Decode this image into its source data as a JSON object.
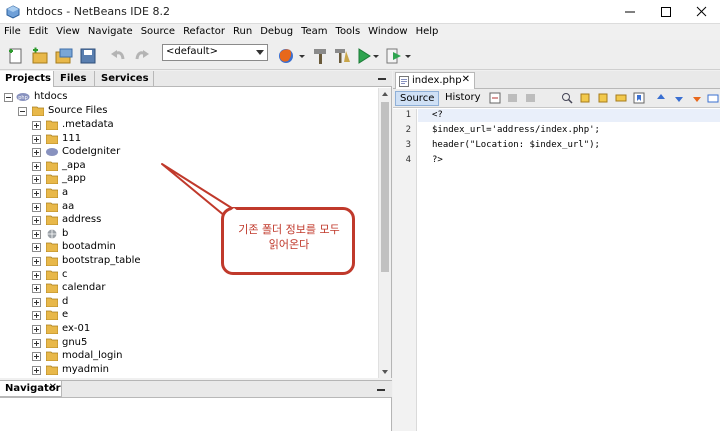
{
  "window": {
    "title": "htdocs - NetBeans IDE 8.2"
  },
  "menu": [
    "File",
    "Edit",
    "View",
    "Navigate",
    "Source",
    "Refactor",
    "Run",
    "Debug",
    "Team",
    "Tools",
    "Window",
    "Help"
  ],
  "toolbar": {
    "config_select": "<default>"
  },
  "left_tabs": {
    "projects": "Projects",
    "files": "Files",
    "services": "Services"
  },
  "tree": {
    "root": "htdocs",
    "source_files": "Source Files",
    "items": [
      ".metadata",
      "111",
      "CodeIgniter",
      "_apa",
      "_app",
      "a",
      "aa",
      "address",
      "b",
      "bootadmin",
      "bootstrap_table",
      "c",
      "calendar",
      "d",
      "e",
      "ex-01",
      "gnu5",
      "modal_login",
      "myadmin"
    ]
  },
  "navigator": {
    "title": "Navigator"
  },
  "editor": {
    "tab": "index.php",
    "source_btn": "Source",
    "history_btn": "History",
    "lines": [
      "<?",
      "$index_url='address/index.php';",
      "header(\"Location: $index_url\");",
      "?>"
    ],
    "line_numbers": [
      "1",
      "2",
      "3",
      "4"
    ]
  },
  "annotation": {
    "text": "기존 폴더 정보를 모두 읽어온다"
  },
  "colors": {
    "annotation": "#c0392b",
    "folder": "#e8b84a"
  }
}
